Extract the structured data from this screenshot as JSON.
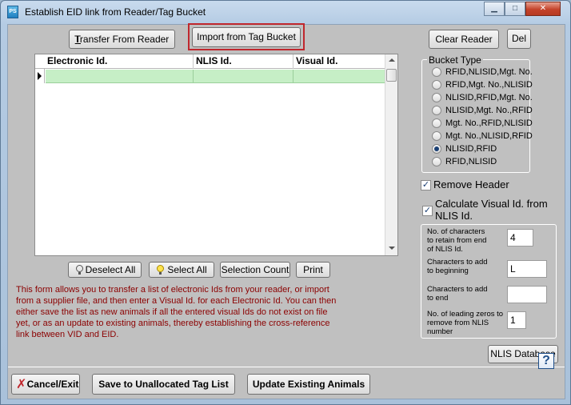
{
  "window": {
    "title": "Establish EID link from Reader/Tag Bucket",
    "icon_text": "PS"
  },
  "toolbar": {
    "transfer_label": "Transfer From Reader",
    "import_label": "Import from Tag Bucket",
    "clear_label": "Clear Reader",
    "del_label": "Del"
  },
  "grid": {
    "columns": [
      "Electronic Id.",
      "NLIS Id.",
      "Visual Id."
    ]
  },
  "bucket_type": {
    "title": "Bucket Type",
    "options": [
      "RFID,NLISID,Mgt. No.",
      "RFID,Mgt. No.,NLISID",
      "NLISID,RFID,Mgt. No.",
      "NLISID,Mgt. No.,RFID",
      "Mgt. No.,RFID,NLISID",
      "Mgt. No.,NLISID,RFID",
      "NLISID,RFID",
      "RFID,NLISID"
    ],
    "selected": "NLISID,RFID"
  },
  "remove_header": {
    "label": "Remove Header",
    "checked": true
  },
  "calc_visual": {
    "label": "Calculate Visual Id. from NLIS Id.",
    "checked": true
  },
  "settings": {
    "chars_retain_label": "No. of characters to retain from end of NLIS Id.",
    "chars_retain_value": "4",
    "chars_begin_label": "Characters to add to beginning",
    "chars_begin_value": "L",
    "chars_end_label": "Characters to add to end",
    "chars_end_value": "",
    "leading_zeros_label": "No. of leading zeros to remove from NLIS number",
    "leading_zeros_value": "1"
  },
  "grid_buttons": {
    "deselect_label": "Deselect All",
    "select_label": "Select All",
    "selection_count_label": "Selection Count",
    "print_label": "Print"
  },
  "info_text": "This form allows you to transfer a list of electronic Ids from your reader, or import from a supplier file, and then enter a Visual Id. for each Electronic Id. You can then either save the list as new animals if all the entered visual Ids do not exist on file yet, or as an update to existing animals, thereby establishing the cross-reference link between VID and EID.",
  "nlis_db_label": "NLIS Database",
  "bottom": {
    "cancel_label": "Cancel/Exit",
    "save_label": "Save to Unallocated Tag List",
    "update_label": "Update Existing Animals"
  },
  "help_glyph": "?",
  "colors": {
    "info_text": "#8b0000",
    "grid_row": "#c6efc6",
    "highlight": "#c0272d"
  }
}
